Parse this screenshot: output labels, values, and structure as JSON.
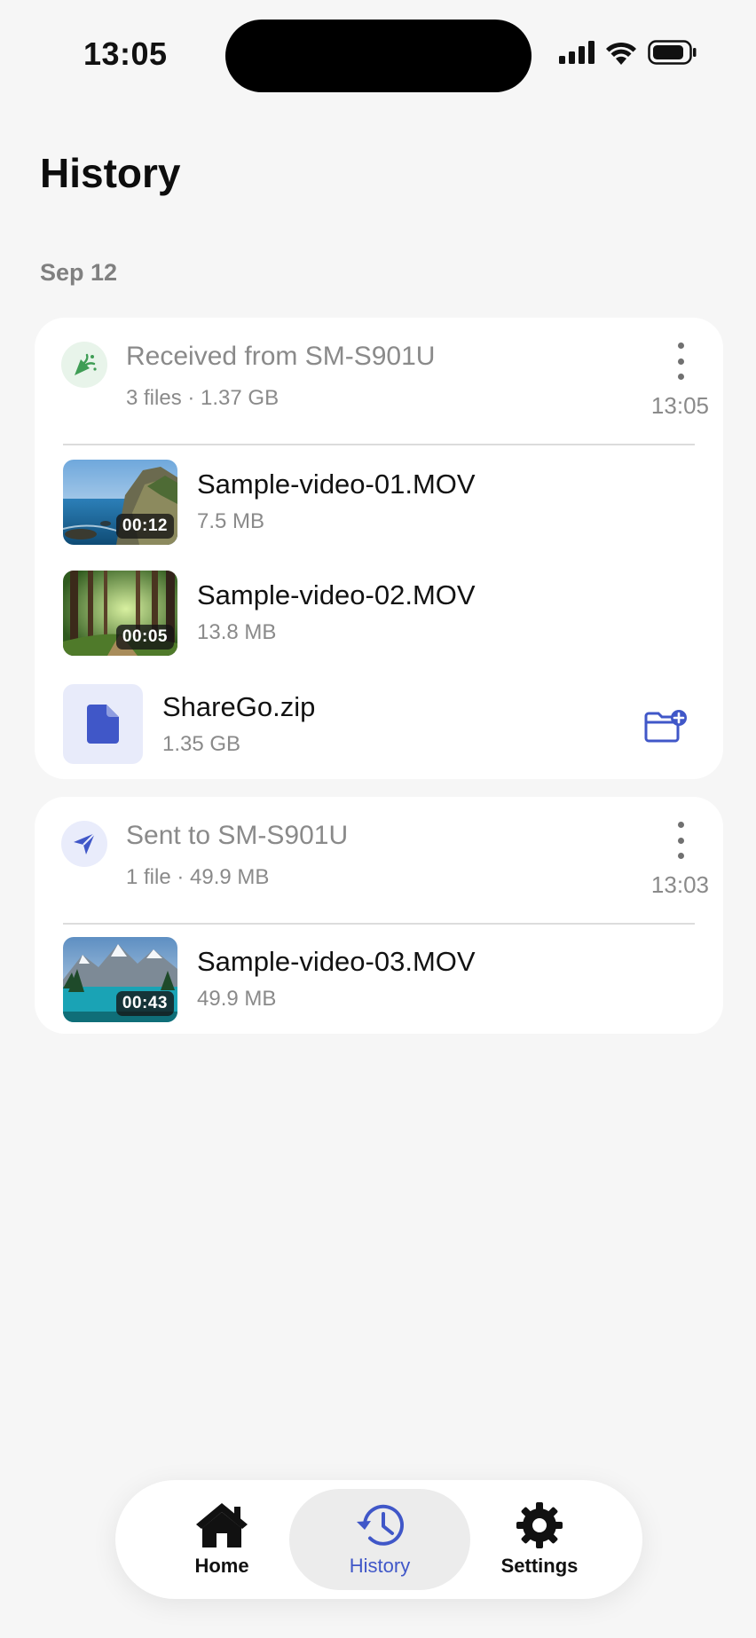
{
  "status_bar": {
    "time": "13:05"
  },
  "header": {
    "title": "History"
  },
  "section": {
    "date": "Sep 12"
  },
  "transfers": [
    {
      "title": "Received from SM-S901U",
      "summary": "3 files · 1.37 GB",
      "time": "13:05",
      "icon": "received-icon",
      "files": [
        {
          "name": "Sample-video-01.MOV",
          "size": "7.5 MB",
          "duration": "00:12"
        },
        {
          "name": "Sample-video-02.MOV",
          "size": "13.8 MB",
          "duration": "00:05"
        },
        {
          "name": "ShareGo.zip",
          "size": "1.35 GB"
        }
      ]
    },
    {
      "title": "Sent to SM-S901U",
      "summary": "1 file · 49.9 MB",
      "time": "13:03",
      "icon": "send-icon",
      "files": [
        {
          "name": "Sample-video-03.MOV",
          "size": "49.9 MB",
          "duration": "00:43"
        }
      ]
    }
  ],
  "nav": {
    "home": "Home",
    "history": "History",
    "settings": "Settings"
  },
  "colors": {
    "accent": "#4057c8",
    "received_accent": "#3f9d55",
    "background": "#f6f6f6"
  }
}
